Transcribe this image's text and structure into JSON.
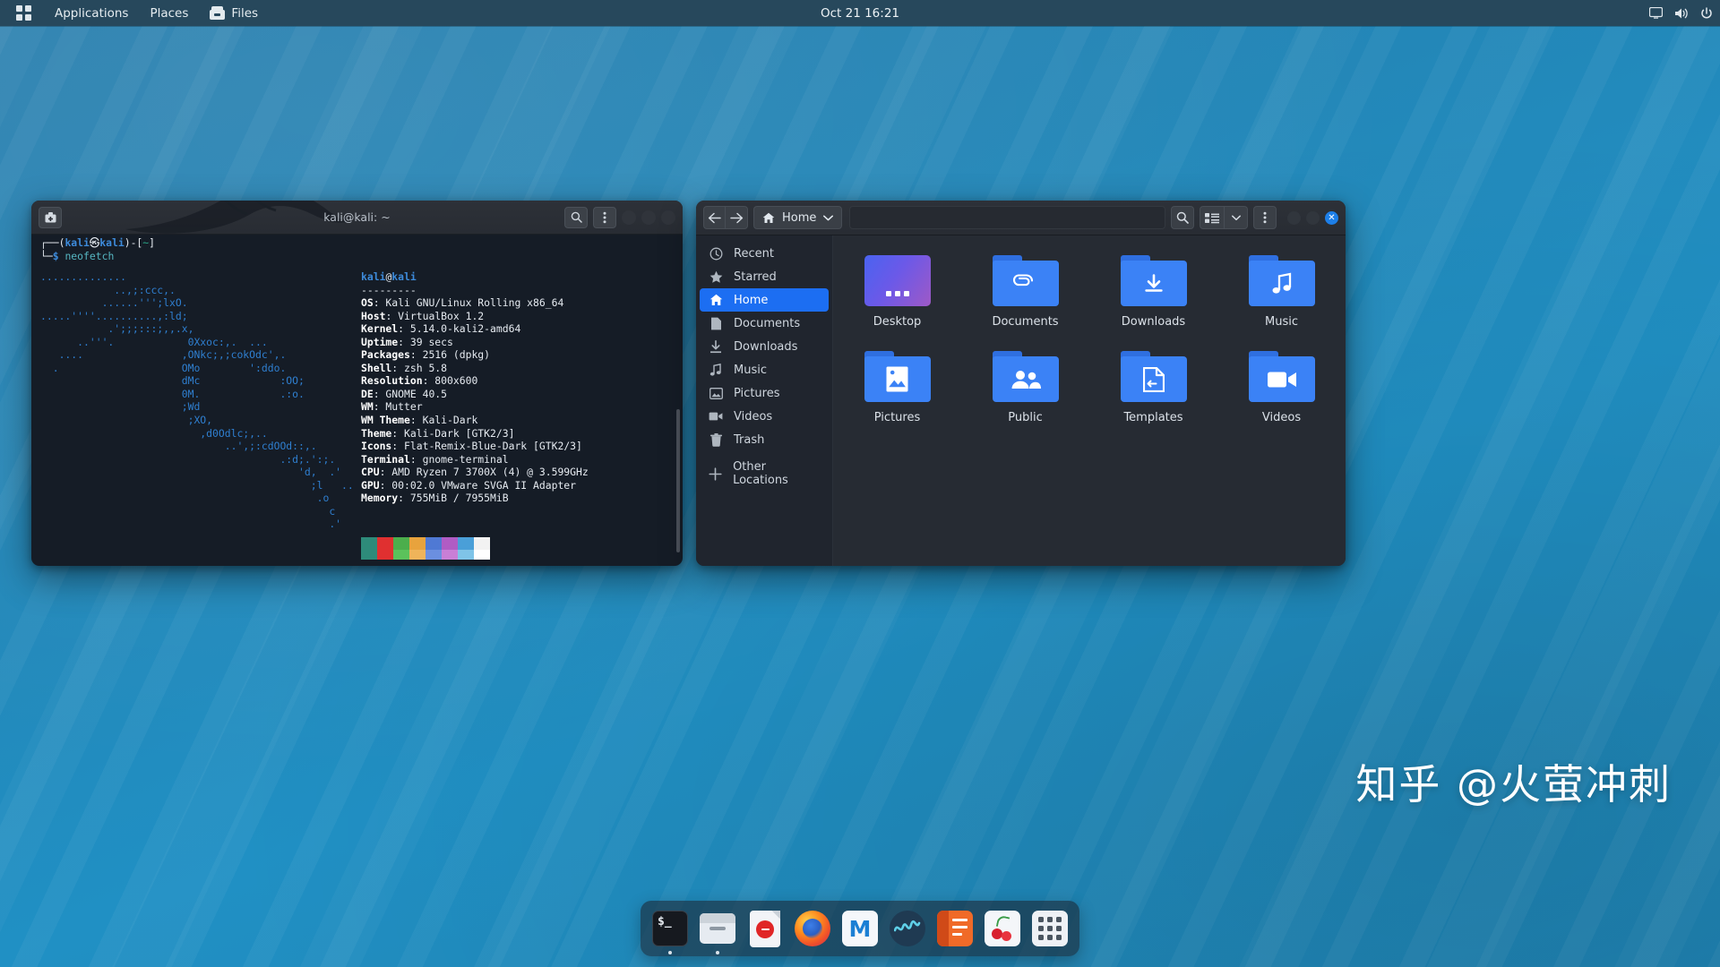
{
  "topbar": {
    "activities_label": "",
    "applications_label": "Applications",
    "places_label": "Places",
    "files_label": "Files",
    "clock": "Oct 21  16:21",
    "icons": [
      "grid-icon",
      "files-icon",
      "display-icon",
      "volume-icon",
      "power-icon"
    ]
  },
  "terminal": {
    "title": "kali@kali: ~",
    "prompt_line1_pre": "┌──(",
    "prompt_user": "kali",
    "prompt_at": "㉿",
    "prompt_host": "kali",
    "prompt_line1_post": ")-[",
    "prompt_path": "~",
    "prompt_line1_end": "]",
    "prompt_line2_sym": "└─$",
    "command": "neofetch",
    "ascii_art": [
      "..............",
      "            ..,;:ccc,.",
      "          ......''';lxO.",
      ".....''''..........,:ld;",
      "           .';;;:::;,,.x,",
      "      ..'''.            0Xxoc:,.  ...",
      "   ....                ,ONkc;,;cokOdc',.",
      "  .                    OMo        ':ddo.",
      "                       dMc             :OO;",
      "                       0M.             .:o.",
      "                       ;Wd",
      "                        ;XO,",
      "                          ,d0Odlc;,..",
      "                              ..',;:cdOOd::,.",
      "                                       .:d;.':;.",
      "                                          'd,  .'",
      "                                            ;l   ..",
      "                                             .o",
      "                                               c",
      "                                               .'"
    ],
    "header_user": "kali",
    "header_at": "@",
    "header_host": "kali",
    "header_rule": "---------",
    "info": [
      {
        "key": "OS",
        "value": "Kali GNU/Linux Rolling x86_64"
      },
      {
        "key": "Host",
        "value": "VirtualBox 1.2"
      },
      {
        "key": "Kernel",
        "value": "5.14.0-kali2-amd64"
      },
      {
        "key": "Uptime",
        "value": "39 secs"
      },
      {
        "key": "Packages",
        "value": "2516 (dpkg)"
      },
      {
        "key": "Shell",
        "value": "zsh 5.8"
      },
      {
        "key": "Resolution",
        "value": "800x600"
      },
      {
        "key": "DE",
        "value": "GNOME 40.5"
      },
      {
        "key": "WM",
        "value": "Mutter"
      },
      {
        "key": "WM Theme",
        "value": "Kali-Dark"
      },
      {
        "key": "Theme",
        "value": "Kali-Dark [GTK2/3]"
      },
      {
        "key": "Icons",
        "value": "Flat-Remix-Blue-Dark [GTK2/3]"
      },
      {
        "key": "Terminal",
        "value": "gnome-terminal"
      },
      {
        "key": "CPU",
        "value": "AMD Ryzen 7 3700X (4) @ 3.599GHz"
      },
      {
        "key": "GPU",
        "value": "00:02.0 VMware SVGA II Adapter"
      },
      {
        "key": "Memory",
        "value": "755MiB / 7955MiB"
      }
    ],
    "palette_row1": [
      "#2e8b7a",
      "#e03030",
      "#4cae4c",
      "#e8a33d",
      "#4f79d4",
      "#b05cc4",
      "#4a9fd8",
      "#f2f2f2"
    ],
    "palette_row2": [
      "#2e8b7a",
      "#e03030",
      "#5bc25b",
      "#efb45a",
      "#6b8fe0",
      "#c97fd6",
      "#7fc4e8",
      "#ffffff"
    ],
    "window_buttons": [
      "search-icon",
      "menu-icon",
      "minimize-button",
      "maximize-button",
      "close-button"
    ]
  },
  "filemanager": {
    "back_label": "←",
    "forward_label": "→",
    "path_label": "Home",
    "search_placeholder": "",
    "search_value": "",
    "sidebar": [
      {
        "label": "Recent",
        "icon": "clock-icon",
        "active": false
      },
      {
        "label": "Starred",
        "icon": "star-icon",
        "active": false
      },
      {
        "label": "Home",
        "icon": "home-icon",
        "active": true
      },
      {
        "label": "Documents",
        "icon": "document-icon",
        "active": false
      },
      {
        "label": "Downloads",
        "icon": "download-icon",
        "active": false
      },
      {
        "label": "Music",
        "icon": "music-icon",
        "active": false
      },
      {
        "label": "Pictures",
        "icon": "image-icon",
        "active": false
      },
      {
        "label": "Videos",
        "icon": "video-icon",
        "active": false
      },
      {
        "label": "Trash",
        "icon": "trash-icon",
        "active": false
      },
      {
        "label": "Other Locations",
        "icon": "plus-icon",
        "active": false
      }
    ],
    "folders": [
      {
        "label": "Desktop",
        "icon": "desktop-icon"
      },
      {
        "label": "Documents",
        "icon": "paperclip-icon"
      },
      {
        "label": "Downloads",
        "icon": "download-icon"
      },
      {
        "label": "Music",
        "icon": "music-icon"
      },
      {
        "label": "Pictures",
        "icon": "image-icon"
      },
      {
        "label": "Public",
        "icon": "people-icon"
      },
      {
        "label": "Templates",
        "icon": "template-icon"
      },
      {
        "label": "Videos",
        "icon": "video-icon"
      }
    ],
    "toolbar_icons": [
      "search-icon",
      "view-grid-icon",
      "chevron-down-icon",
      "menu-icon"
    ],
    "window_buttons": [
      "minimize-button",
      "maximize-button",
      "close-button"
    ],
    "accent_color": "#1c6ef2"
  },
  "dock": {
    "items": [
      {
        "name": "terminal",
        "running": true
      },
      {
        "name": "files",
        "running": true
      },
      {
        "name": "pdf-viewer",
        "running": false
      },
      {
        "name": "firefox",
        "running": false
      },
      {
        "name": "metasploit",
        "running": false
      },
      {
        "name": "burpsuite",
        "running": false
      },
      {
        "name": "text-editor",
        "running": false
      },
      {
        "name": "cherrytree",
        "running": false
      },
      {
        "name": "show-apps",
        "running": false
      }
    ]
  },
  "watermark": {
    "text": "知乎 @火萤冲刺"
  },
  "colors": {
    "desktop_blue": "#1d8cbf",
    "accent_blue": "#1c6ef2",
    "folder_blue": "#3b82f6",
    "topbar": "#27485c",
    "terminal_bg": "#151c26"
  }
}
